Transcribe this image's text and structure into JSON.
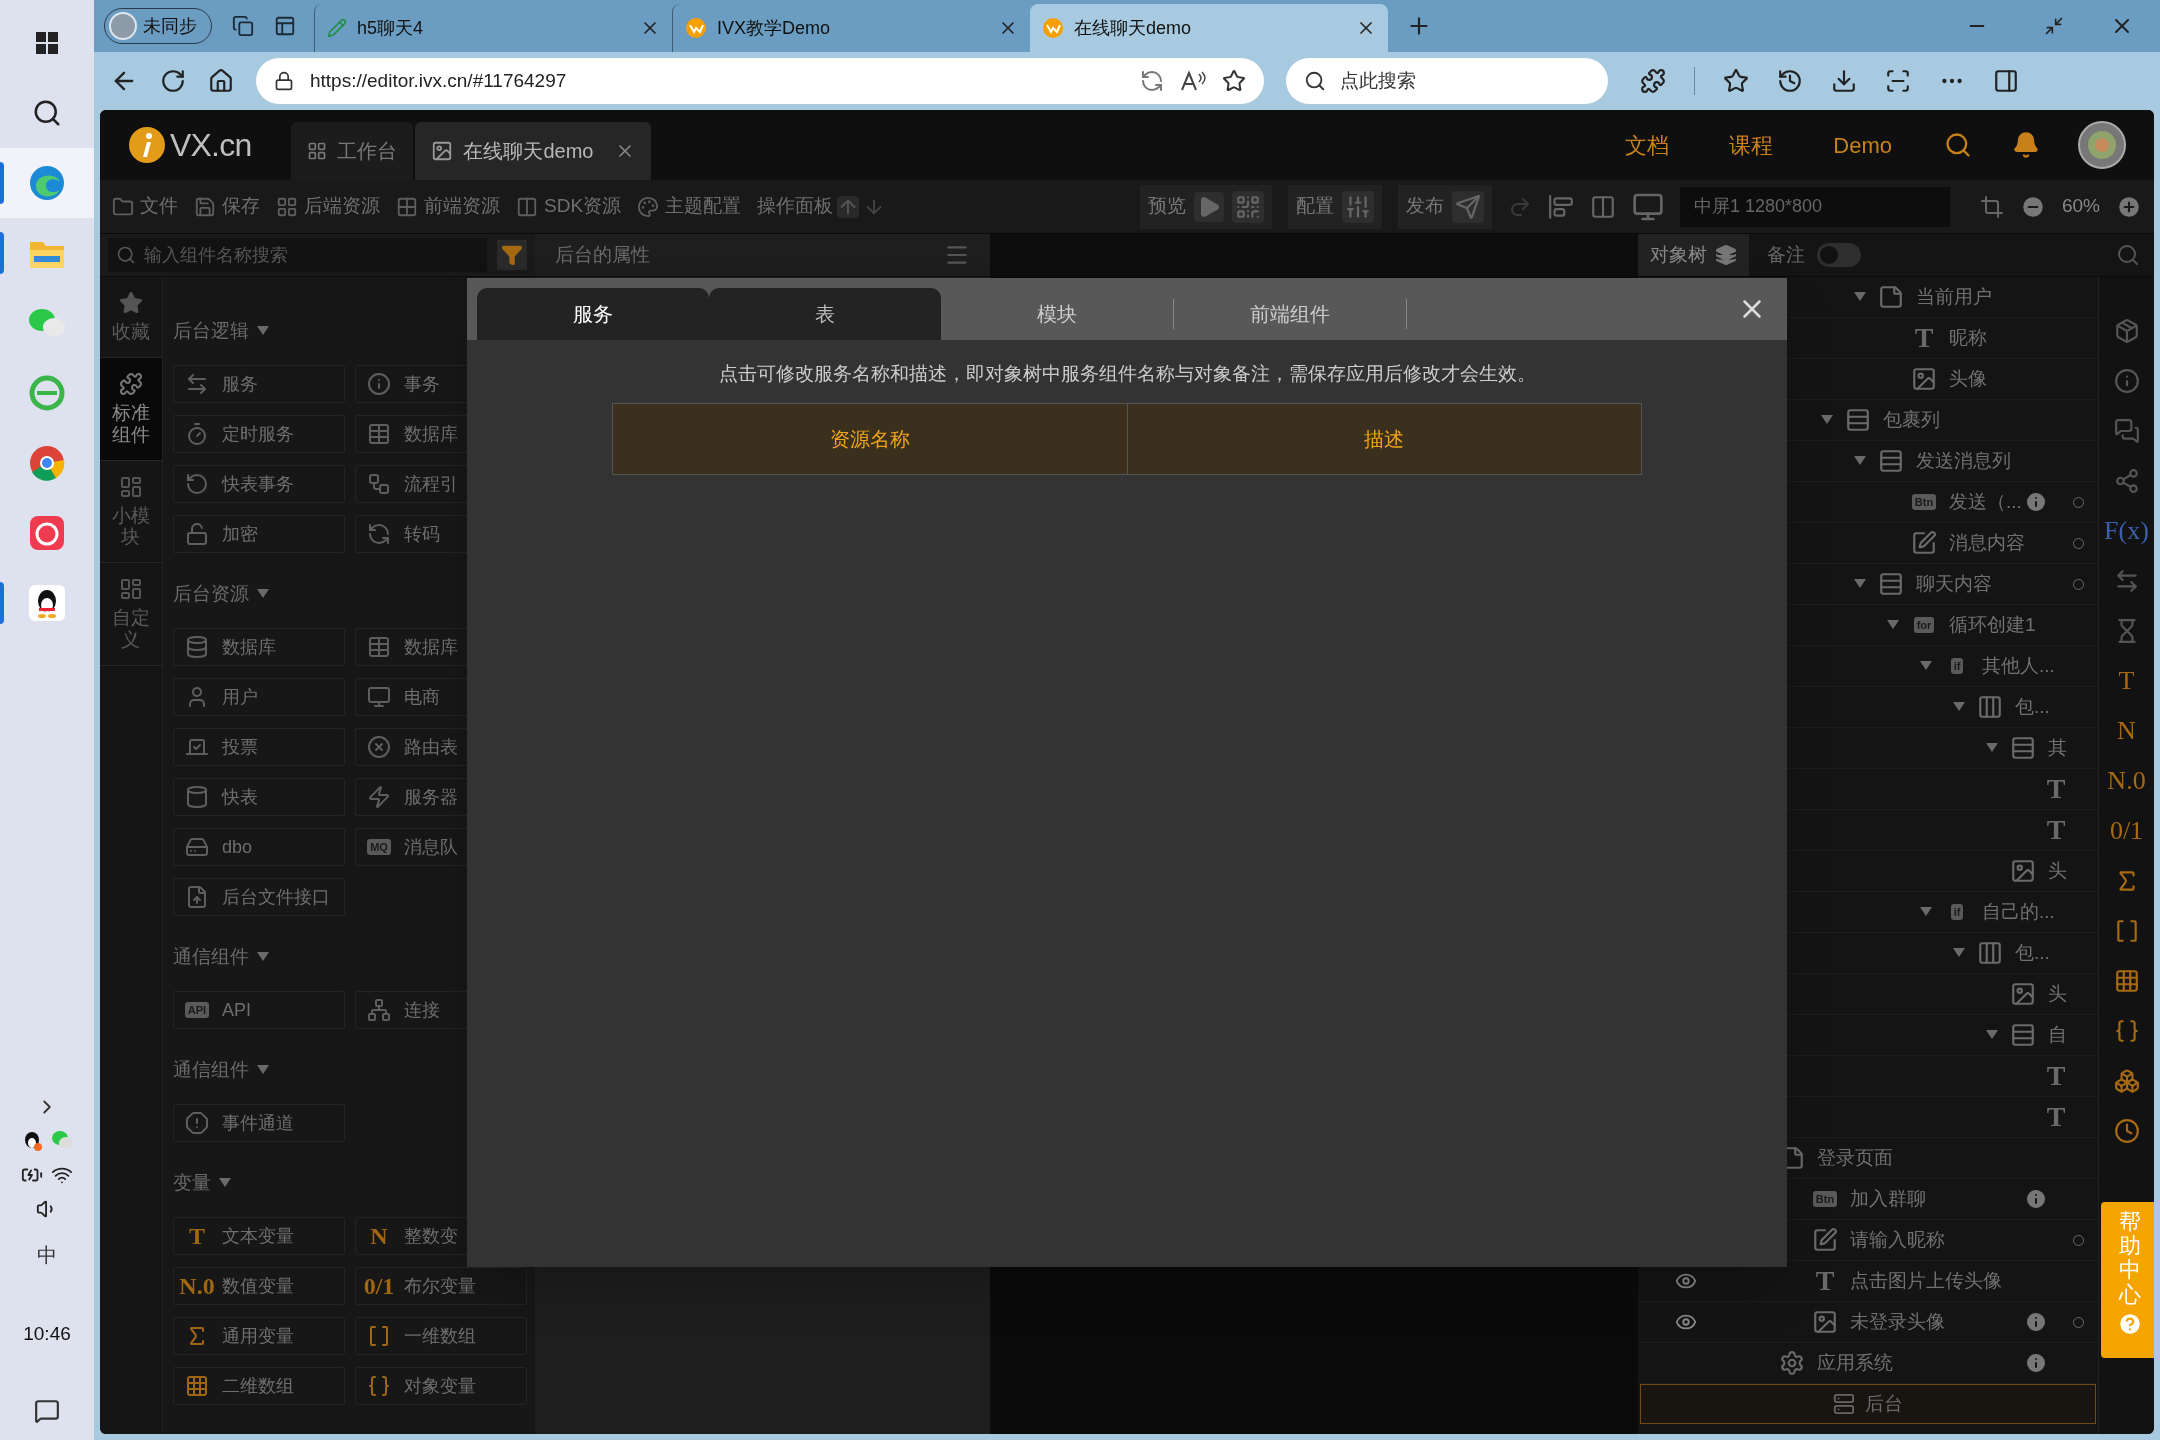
{
  "taskbar": {
    "apps": [
      {
        "kind": "windows",
        "running": false,
        "selected": false
      },
      {
        "kind": "search",
        "running": false,
        "selected": false
      },
      {
        "kind": "edge",
        "running": true,
        "selected": true
      },
      {
        "kind": "folder",
        "running": true,
        "selected": false
      },
      {
        "kind": "chat",
        "running": false,
        "selected": false
      },
      {
        "kind": "globe",
        "running": false,
        "selected": false
      },
      {
        "kind": "chrome",
        "running": false,
        "selected": false
      },
      {
        "kind": "red",
        "running": false,
        "selected": false
      },
      {
        "kind": "penguin",
        "running": true,
        "selected": false
      }
    ],
    "ime": "中",
    "time": "10:46"
  },
  "browser": {
    "profile": "未同步",
    "tabs": [
      {
        "title": "h5聊天4",
        "selected": false
      },
      {
        "title": "IVX教学Demo",
        "selected": false
      },
      {
        "title": "在线聊天demo",
        "selected": true
      }
    ],
    "url": "https://editor.ivx.cn/#11764297",
    "search_placeholder": "点此搜索"
  },
  "app": {
    "logo": "VX.cn",
    "tabs": [
      {
        "label": "工作台",
        "selected": false
      },
      {
        "label": "在线聊天demo",
        "selected": true
      }
    ],
    "links": [
      "文档",
      "课程",
      "Demo"
    ]
  },
  "toolbar": {
    "items": [
      "文件",
      "保存",
      "后端资源",
      "前端资源",
      "SDK资源",
      "主题配置"
    ],
    "panel_label": "操作面板",
    "preview": "预览",
    "config": "配置",
    "publish": "发布",
    "device": "中屏1 1280*800",
    "zoom": "60%"
  },
  "panels": {
    "search_placeholder": "输入组件名称搜索",
    "properties_title": "后台的属性",
    "tree_tab": "对象树",
    "note_label": "备注",
    "note_on": false
  },
  "rail": [
    {
      "label": "收藏",
      "kind": "star",
      "selected": false
    },
    {
      "label": "标准组件",
      "kind": "puzzle",
      "selected": true
    },
    {
      "label": "小模块",
      "kind": "blocks",
      "selected": false
    },
    {
      "label": "自定义",
      "kind": "blocks",
      "selected": false
    }
  ],
  "sections": [
    {
      "title": "后台逻辑",
      "items": [
        {
          "label": "服务",
          "kind": "swap"
        },
        {
          "label": "事务",
          "kind": "info"
        },
        {
          "label": "定时服务",
          "kind": "timer"
        },
        {
          "label": "数据库",
          "kind": "table"
        },
        {
          "label": "快表事务",
          "kind": "rotate"
        },
        {
          "label": "流程引",
          "kind": "flow"
        },
        {
          "label": "加密",
          "kind": "lock"
        },
        {
          "label": "转码",
          "kind": "refresh"
        }
      ]
    },
    {
      "title": "后台资源",
      "items": [
        {
          "label": "数据库",
          "kind": "database"
        },
        {
          "label": "数据库",
          "kind": "table"
        },
        {
          "label": "用户",
          "kind": "user"
        },
        {
          "label": "电商",
          "kind": "monitor"
        },
        {
          "label": "投票",
          "kind": "vote"
        },
        {
          "label": "路由表",
          "kind": "xcircle"
        },
        {
          "label": "快表",
          "kind": "cylinder"
        },
        {
          "label": "服务器",
          "kind": "zap"
        },
        {
          "label": "dbo",
          "kind": "drive"
        },
        {
          "label": "消息队",
          "badge": "MQ"
        },
        {
          "label": "后台文件接口",
          "kind": "fileup"
        }
      ]
    },
    {
      "title": "通信组件",
      "items": [
        {
          "label": "API",
          "badge": "API"
        },
        {
          "label": "连接",
          "kind": "network"
        }
      ]
    },
    {
      "title": "通信组件",
      "items": [
        {
          "label": "事件通道",
          "kind": "alert"
        }
      ]
    },
    {
      "title": "变量",
      "items": [
        {
          "label": "文本变量",
          "glyph": "T"
        },
        {
          "label": "整数变",
          "glyph": "N"
        },
        {
          "label": "数值变量",
          "glyph": "N.0"
        },
        {
          "label": "布尔变量",
          "glyph": "0/1"
        },
        {
          "label": "通用变量",
          "kind": "chi"
        },
        {
          "label": "一维数组",
          "kind": "brackets"
        },
        {
          "label": "二维数组",
          "kind": "grid3"
        },
        {
          "label": "对象变量",
          "kind": "braces"
        }
      ]
    }
  ],
  "modal": {
    "tabs": [
      {
        "label": "服务",
        "selected": true,
        "hovered": false
      },
      {
        "label": "表",
        "selected": false,
        "hovered": true
      },
      {
        "label": "模块",
        "selected": false,
        "hovered": false
      },
      {
        "label": "前端组件",
        "selected": false,
        "hovered": false
      }
    ],
    "notice": "点击可修改服务名称和描述，即对象树中服务组件名称与对象备注，需保存应用后修改才会生效。",
    "columns": [
      "资源名称",
      "描述"
    ]
  },
  "tree": {
    "continued": [
      {
        "label": "当前用户",
        "kind": "page",
        "expanded": true,
        "children": [
          {
            "label": "昵称",
            "glyph": "T"
          },
          {
            "label": "头像",
            "kind": "image"
          }
        ]
      }
    ],
    "continued_outer": [
      {
        "label": "包裹列",
        "kind": "column",
        "expanded": true,
        "children": [
          {
            "label": "发送消息列",
            "kind": "column",
            "expanded": true,
            "children": [
              {
                "label": "发送（...",
                "badge": "Btn",
                "info": true,
                "dot": true
              },
              {
                "label": "消息内容",
                "kind": "edit",
                "dot": true
              }
            ]
          },
          {
            "label": "聊天内容",
            "kind": "column",
            "expanded": true,
            "dot": true,
            "children": [
              {
                "label": "循环创建1",
                "badge": "for",
                "expanded": true,
                "children": [
                  {
                    "label": "其他人...",
                    "badge": "if",
                    "expanded": true,
                    "children": [
                      {
                        "label": "包...",
                        "kind": "row",
                        "expanded": true,
                        "children": [
                          {
                            "label": "其",
                            "kind": "column",
                            "expanded": true,
                            "children": [
                              {
                                "glyph": "T"
                              },
                              {
                                "glyph": "T"
                              }
                            ]
                          },
                          {
                            "label": "头",
                            "kind": "image"
                          }
                        ]
                      }
                    ]
                  },
                  {
                    "label": "自己的...",
                    "badge": "if",
                    "expanded": true,
                    "children": [
                      {
                        "label": "包...",
                        "kind": "row",
                        "expanded": true,
                        "children": [
                          {
                            "label": "头",
                            "kind": "image"
                          },
                          {
                            "label": "自",
                            "kind": "column",
                            "expanded": true,
                            "children": [
                              {
                                "glyph": "T"
                              },
                              {
                                "glyph": "T"
                              }
                            ]
                          }
                        ]
                      }
                    ]
                  }
                ]
              }
            ]
          }
        ]
      }
    ],
    "items": [
      {
        "label": "登录页面",
        "kind": "page",
        "children": [
          {
            "label": "加入群聊",
            "badge": "Btn",
            "info": true
          },
          {
            "label": "请输入昵称",
            "kind": "edit",
            "dot": true
          },
          {
            "label": "点击图片上传头像",
            "glyph": "T",
            "eye": true
          },
          {
            "label": "未登录头像",
            "kind": "image",
            "eye": true,
            "info": true,
            "dot": true
          }
        ]
      },
      {
        "label": "应用系统",
        "kind": "gear",
        "info": true
      }
    ],
    "backend": "后台"
  },
  "right_rail": [
    {
      "kind": "cube"
    },
    {
      "kind": "info"
    },
    {
      "kind": "chat"
    },
    {
      "kind": "share"
    },
    {
      "glyph": "F(x)",
      "color": "#3b5fa8"
    },
    {
      "kind": "swap"
    },
    {
      "kind": "hourglass"
    },
    {
      "glyph": "T",
      "color": "#a66a12"
    },
    {
      "glyph": "N",
      "color": "#a66a12"
    },
    {
      "glyph": "N.0",
      "color": "#a66a12"
    },
    {
      "glyph": "0/1",
      "color": "#a66a12"
    },
    {
      "kind": "chi",
      "color": "#a66a12"
    },
    {
      "kind": "brackets",
      "color": "#a66a12"
    },
    {
      "kind": "grid3",
      "color": "#a66a12"
    },
    {
      "kind": "braces",
      "color": "#a66a12"
    },
    {
      "kind": "boxes",
      "color": "#a66a12"
    },
    {
      "kind": "clock",
      "color": "#a66a12"
    }
  ],
  "help": "帮助中心"
}
